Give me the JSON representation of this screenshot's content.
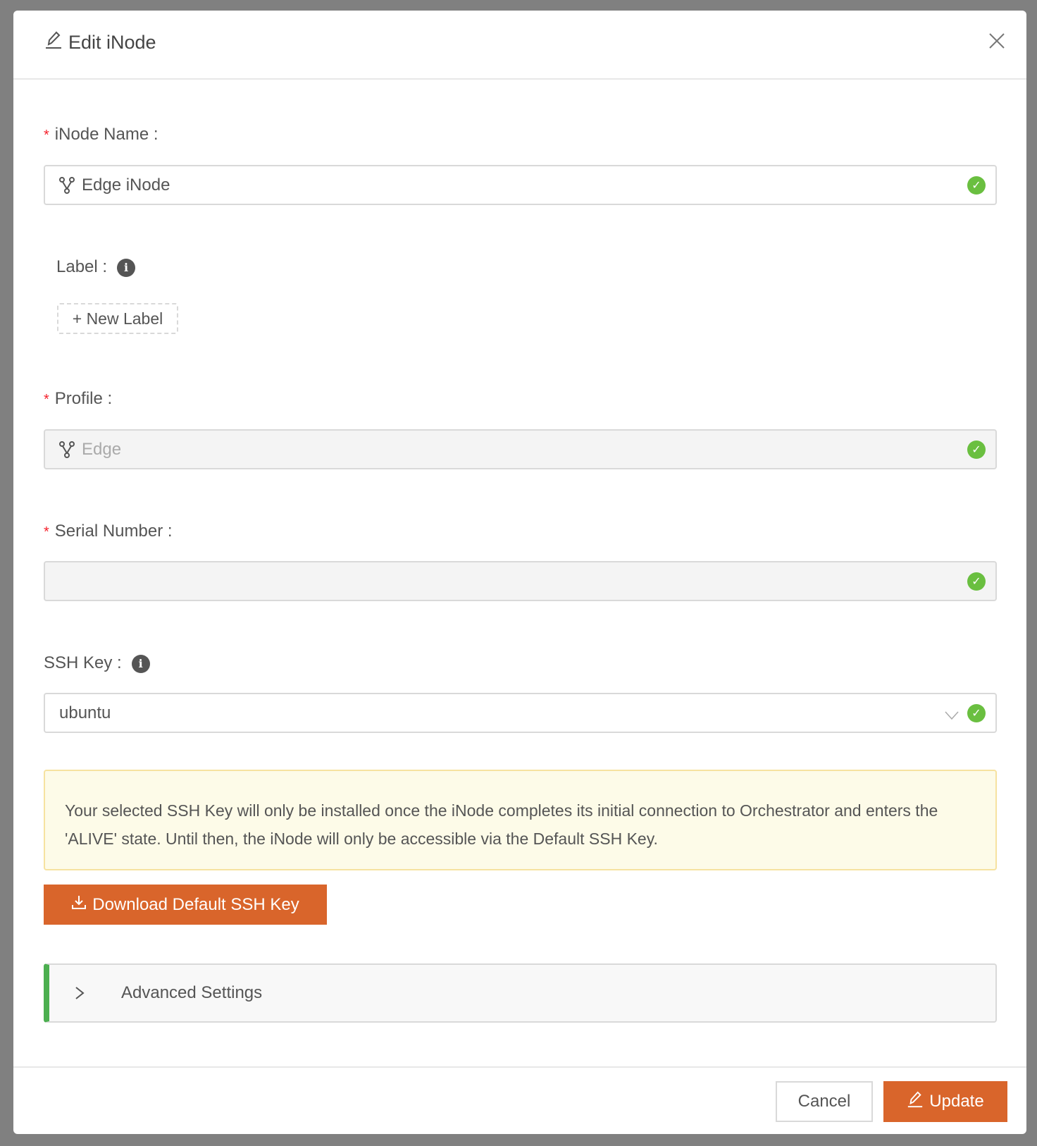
{
  "modal": {
    "title": "Edit iNode",
    "close_label": "×"
  },
  "fields": {
    "name": {
      "label": "iNode Name",
      "value": "Edge iNode",
      "required": true
    },
    "label": {
      "label": "Label",
      "new_label": "+ New Label"
    },
    "profile": {
      "label": "Profile",
      "value": "Edge",
      "required": true,
      "disabled": true
    },
    "serial": {
      "label": "Serial Number",
      "value": "",
      "required": true,
      "disabled": true
    },
    "ssh_key": {
      "label": "SSH Key",
      "value": "ubuntu"
    }
  },
  "alert": {
    "text": "Your selected SSH Key will only be installed once the iNode completes its initial connection to Orchestrator and enters the 'ALIVE' state. Until then, the iNode will only be accessible via the Default SSH Key."
  },
  "download_button": "Download Default SSH Key",
  "advanced": {
    "label": "Advanced Settings",
    "expanded": false
  },
  "footer": {
    "cancel": "Cancel",
    "update": "Update"
  },
  "colors": {
    "primary": "#d9652b",
    "success": "#6abf40",
    "accent_bar": "#4caf50",
    "alert_bg": "#fdfbe8"
  }
}
